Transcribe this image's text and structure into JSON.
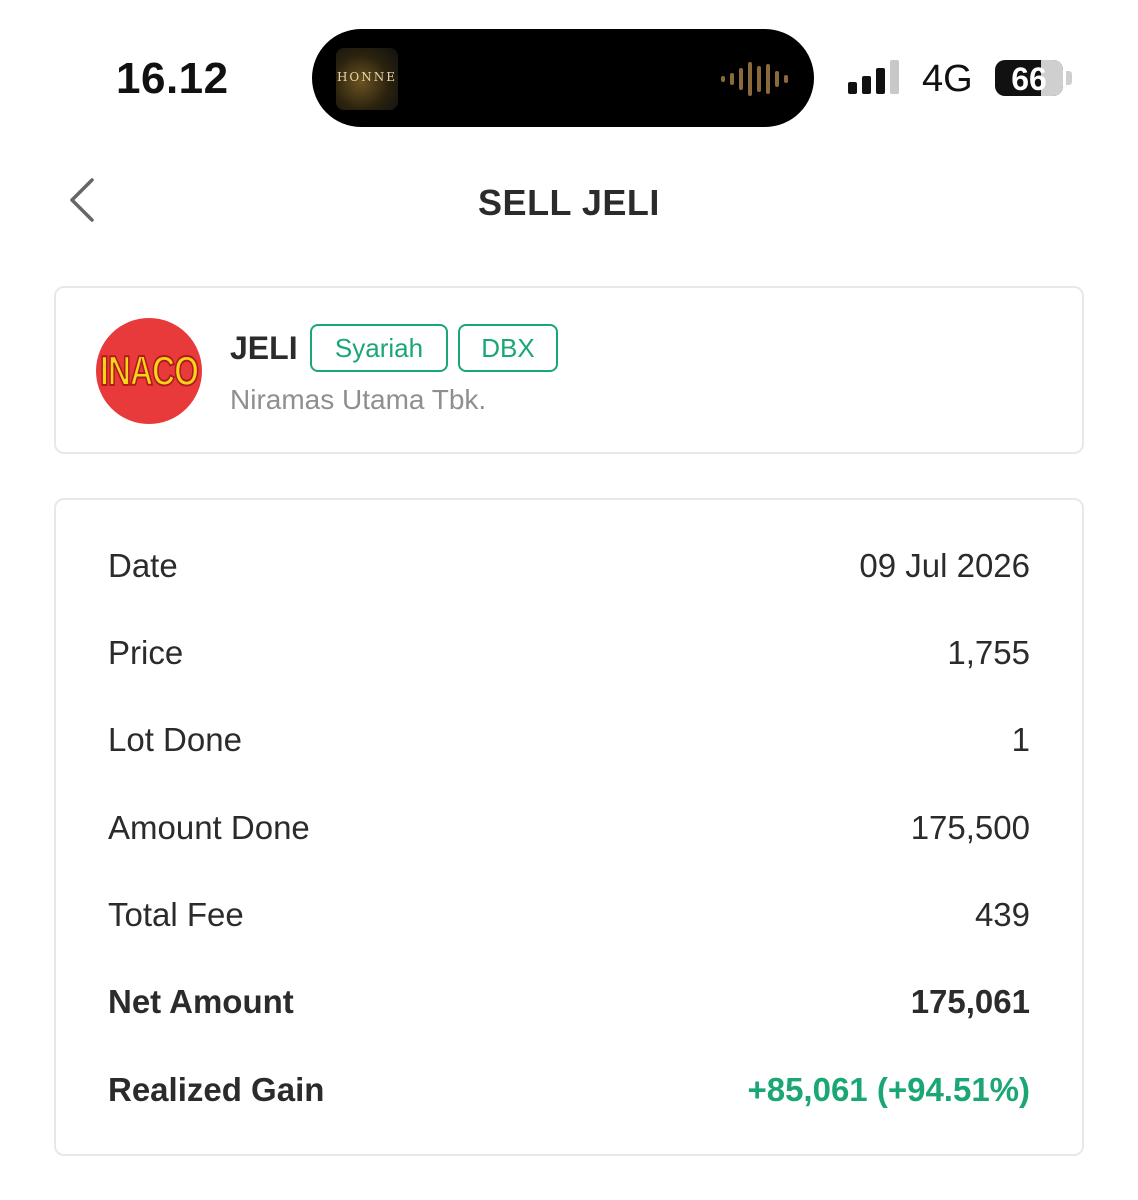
{
  "status_bar": {
    "time": "16.12",
    "now_playing_art_text": "HONNE",
    "network": "4G",
    "battery": "66",
    "battery_level_percent": 66
  },
  "header": {
    "back_icon": "chevron-left-icon",
    "title": "SELL JELI"
  },
  "stock": {
    "logo_text": "INACO",
    "ticker": "JELI",
    "tags": [
      "Syariah",
      "DBX"
    ],
    "company_name": "Niramas Utama Tbk."
  },
  "details": [
    {
      "label": "Date",
      "value": "09 Jul 2026"
    },
    {
      "label": "Price",
      "value": "1,755"
    },
    {
      "label": "Lot Done",
      "value": "1"
    },
    {
      "label": "Amount Done",
      "value": "175,500"
    },
    {
      "label": "Total Fee",
      "value": "439"
    },
    {
      "label": "Net Amount",
      "value": "175,061"
    },
    {
      "label": "Realized Gain",
      "value": "+85,061 (+94.51%)"
    }
  ],
  "colors": {
    "accent_green": "#1aa774",
    "logo_red": "#e83a3a",
    "logo_yellow": "#f7d51a",
    "text_dark": "#2b2b2b",
    "text_muted": "#8f8f8f",
    "card_border": "#e8e8e8"
  }
}
